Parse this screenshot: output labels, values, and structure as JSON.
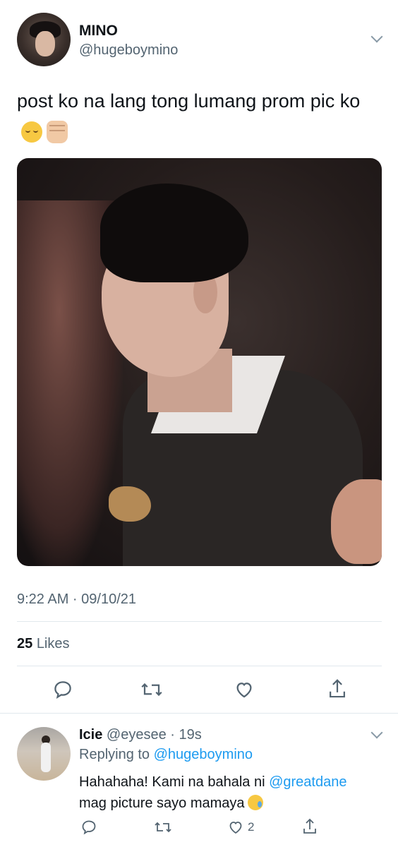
{
  "tweet": {
    "display_name": "MINO",
    "handle": "@hugeboymino",
    "text": "post ko na lang tong lumang prom pic ko",
    "emojis": [
      "pensive-face",
      "raised-fist-light-skin"
    ],
    "timestamp": "9:22 AM · 09/10/21",
    "likes_count": "25",
    "likes_label": "Likes",
    "actions": [
      "reply-icon",
      "retweet-icon",
      "like-icon",
      "share-icon"
    ]
  },
  "reply": {
    "display_name": "Icie",
    "handle": "@eyesee",
    "age": "19s",
    "replying_prefix": "Replying to",
    "replying_handle": "@hugeboymino",
    "text_before": "Hahahaha! Kami na bahala ni",
    "mention": "@greatdane",
    "text_after": "mag picture sayo mamaya",
    "emoji": "face-holding-back-tears",
    "like_count": "2",
    "actions": [
      "reply-icon",
      "retweet-icon",
      "like-icon",
      "share-icon"
    ]
  },
  "colors": {
    "text": "#0f1419",
    "muted": "#536471",
    "link": "#1d9bf0",
    "divider": "#e1e8ed"
  }
}
